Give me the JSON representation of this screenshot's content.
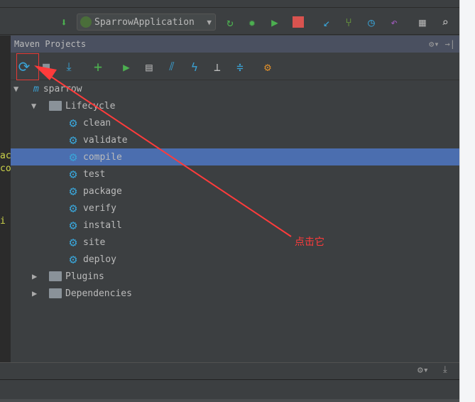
{
  "toolbar": {
    "run_config": "SparrowApplication",
    "icons": [
      "binary-icon",
      "rerun-icon",
      "debug-icon",
      "coverage-icon",
      "stop-icon",
      "vcs-update-icon",
      "vcs-commit-icon",
      "history-icon",
      "revert-icon",
      "project-structure-icon",
      "search-icon"
    ]
  },
  "editor": {
    "fragments": [
      "ac",
      "co",
      "i"
    ]
  },
  "maven": {
    "title": "Maven Projects",
    "toolbar_icons": [
      "reimport-icon",
      "generate-sources-icon",
      "download-icon",
      "add-icon",
      "run-icon",
      "execute-goal-icon",
      "toggle-offline-icon",
      "skip-tests-icon",
      "dependencies-diagram-icon",
      "collapse-all-icon",
      "settings-icon"
    ],
    "tree": {
      "project": "sparrow",
      "lifecycle": "Lifecycle",
      "goals": [
        "clean",
        "validate",
        "compile",
        "test",
        "package",
        "verify",
        "install",
        "site",
        "deploy"
      ],
      "selected": "compile",
      "plugins": "Plugins",
      "dependencies": "Dependencies"
    }
  },
  "annotation": {
    "text": "点击它",
    "color": "#ff3b3b"
  },
  "colors": {
    "selection": "#4b6eaf",
    "header": "#4a5060",
    "gear": "#3aa3d6"
  }
}
